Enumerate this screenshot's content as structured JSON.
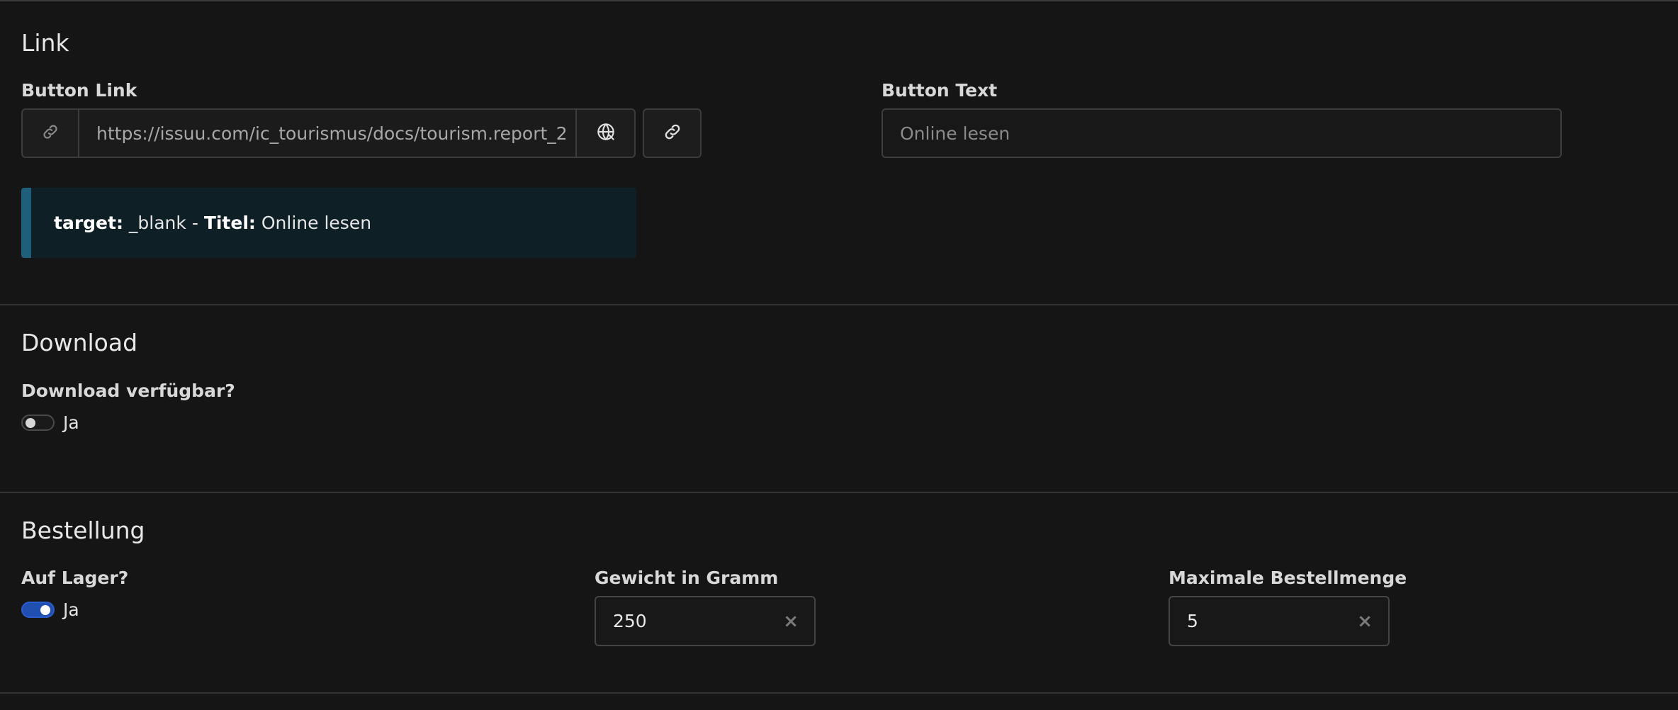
{
  "link_section": {
    "title": "Link",
    "button_link_label": "Button Link",
    "button_link_value": "https://issuu.com/ic_tourismus/docs/tourism.report_2",
    "button_text_label": "Button Text",
    "button_text_placeholder": "Online lesen",
    "info": {
      "target_key": "target:",
      "target_value": "_blank",
      "separator": "-",
      "title_key": "Titel:",
      "title_value": "Online lesen"
    }
  },
  "download_section": {
    "title": "Download",
    "available_label": "Download verfügbar?",
    "toggle_label": "Ja",
    "toggle_on": false
  },
  "order_section": {
    "title": "Bestellung",
    "in_stock_label": "Auf Lager?",
    "toggle_label": "Ja",
    "toggle_on": true,
    "weight_label": "Gewicht in Gramm",
    "weight_value": "250",
    "max_qty_label": "Maximale Bestellmenge",
    "max_qty_value": "5"
  },
  "colors": {
    "background": "#151515",
    "toggle_on": "#1f4fb0",
    "info_accent": "#1f5f7c"
  }
}
